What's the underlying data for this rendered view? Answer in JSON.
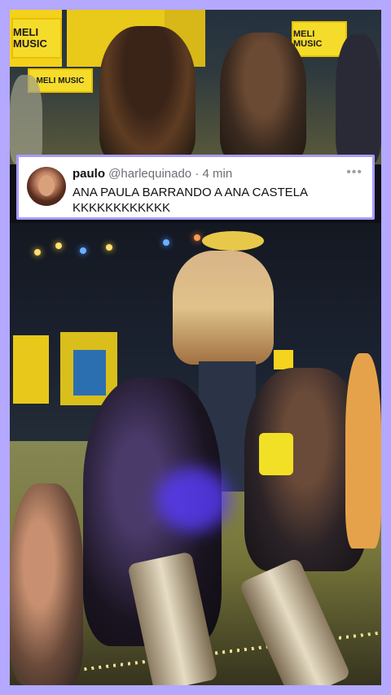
{
  "tweet": {
    "name": "paulo",
    "handle": "@harlequinado",
    "separator": "·",
    "time": "4 min",
    "text": "ANA PAULA BARRANDO A ANA CASTELA KKKKKKKKKKKK",
    "more": "•••"
  },
  "scene": {
    "brand_1": "MELI MUSIC",
    "brand_2": "MELI MUSIC",
    "brand_3": "MELI MUSIC"
  },
  "colors": {
    "border": "#b4a8ff",
    "brand_yellow": "#f5dc2b"
  }
}
